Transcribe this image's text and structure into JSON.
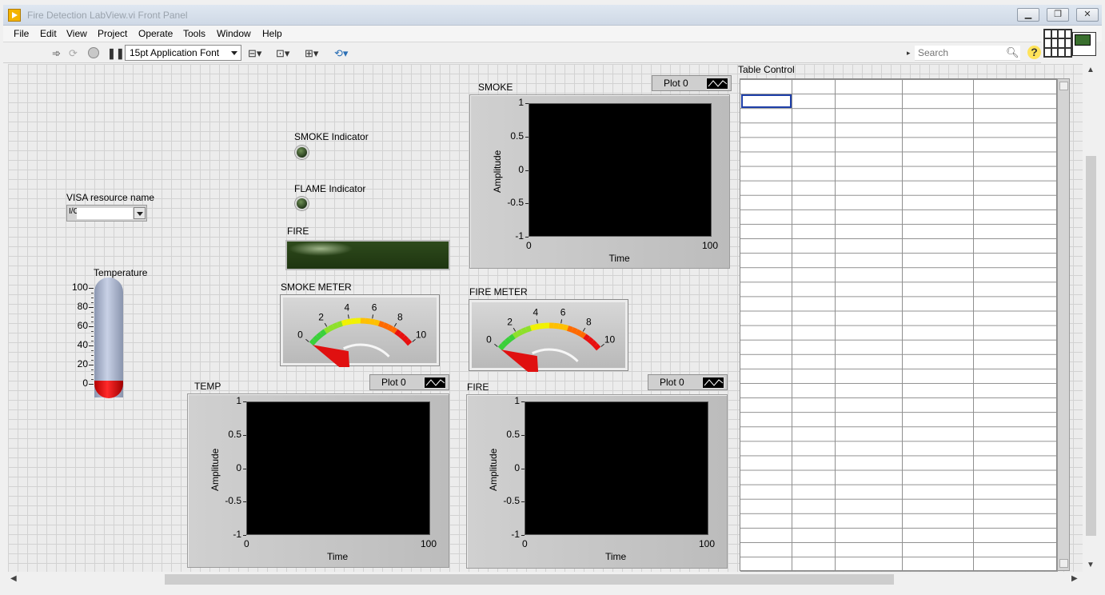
{
  "window": {
    "title": "Fire Detection LabView.vi Front Panel",
    "controls": {
      "minimize": "▁",
      "maximize": "❐",
      "close": "✕"
    }
  },
  "menu": [
    "File",
    "Edit",
    "View",
    "Project",
    "Operate",
    "Tools",
    "Window",
    "Help"
  ],
  "toolbar": {
    "font": "15pt Application Font",
    "search_placeholder": "Search",
    "help": "?"
  },
  "panel": {
    "visa_label": "VISA resource name",
    "visa_icon": "I/O",
    "smoke_indicator_label": "SMOKE Indicator",
    "flame_indicator_label": "FLAME Indicator",
    "fire_label": "FIRE",
    "temperature": {
      "label": "Temperature",
      "ticks": [
        "100",
        "80",
        "60",
        "40",
        "20",
        "0"
      ],
      "value": 0
    },
    "smoke_meter": {
      "label": "SMOKE METER",
      "ticks": [
        "0",
        "2",
        "4",
        "6",
        "8",
        "10"
      ],
      "value": 0
    },
    "fire_meter": {
      "label": "FIRE METER",
      "ticks": [
        "0",
        "2",
        "4",
        "6",
        "8",
        "10"
      ],
      "value": 0
    },
    "table_label": "Table Control"
  },
  "charts": {
    "smoke": {
      "title": "SMOKE",
      "legend": "Plot 0",
      "ylabel": "Amplitude",
      "xlabel": "Time",
      "yticks": [
        "1",
        "0.5",
        "0",
        "-0.5",
        "-1"
      ],
      "xticks": [
        "0",
        "100"
      ]
    },
    "temp": {
      "title": "TEMP",
      "legend": "Plot 0",
      "ylabel": "Amplitude",
      "xlabel": "Time",
      "yticks": [
        "1",
        "0.5",
        "0",
        "-0.5",
        "-1"
      ],
      "xticks": [
        "0",
        "100"
      ]
    },
    "fire": {
      "title": "FIRE",
      "legend": "Plot 0",
      "ylabel": "Amplitude",
      "xlabel": "Time",
      "yticks": [
        "1",
        "0.5",
        "0",
        "-0.5",
        "-1"
      ],
      "xticks": [
        "0",
        "100"
      ]
    }
  }
}
